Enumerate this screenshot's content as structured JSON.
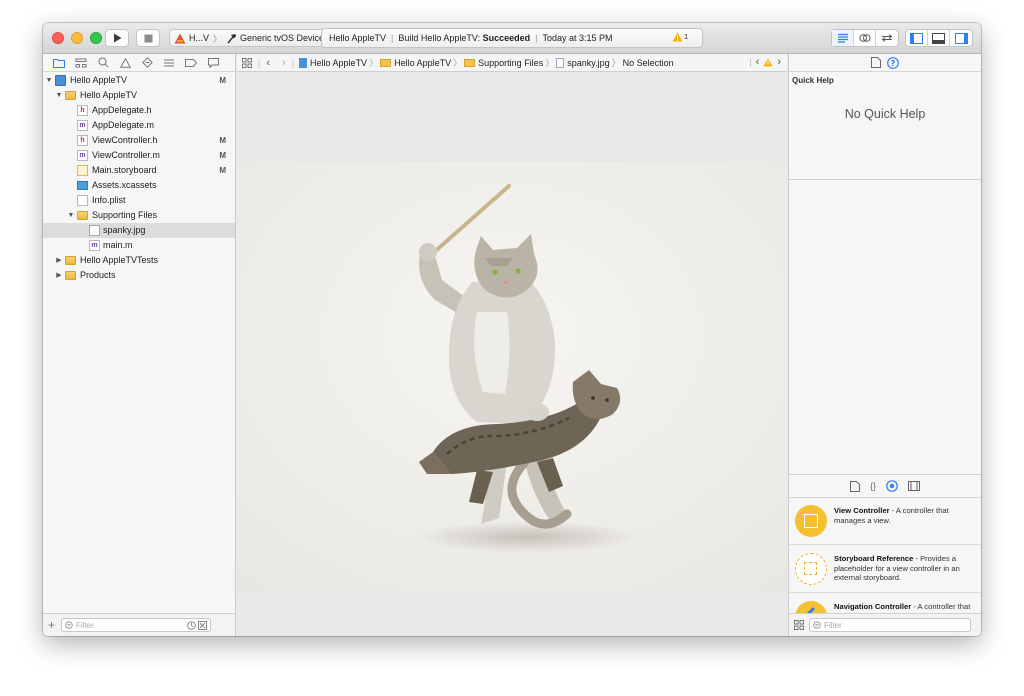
{
  "toolbar": {
    "scheme_short": "H...V",
    "destination": "Generic tvOS Device",
    "activity_project": "Hello AppleTV",
    "activity_status_prefix": "Build Hello AppleTV:",
    "activity_status_result": "Succeeded",
    "activity_time": "Today at 3:15 PM",
    "warning_count": "1"
  },
  "navigator": {
    "items": [
      {
        "label": "Hello AppleTV",
        "badge": "M"
      },
      {
        "label": "Hello AppleTV",
        "badge": ""
      },
      {
        "label": "AppDelegate.h",
        "badge": ""
      },
      {
        "label": "AppDelegate.m",
        "badge": ""
      },
      {
        "label": "ViewController.h",
        "badge": "M"
      },
      {
        "label": "ViewController.m",
        "badge": "M"
      },
      {
        "label": "Main.storyboard",
        "badge": "M"
      },
      {
        "label": "Assets.xcassets",
        "badge": ""
      },
      {
        "label": "Info.plist",
        "badge": ""
      },
      {
        "label": "Supporting Files",
        "badge": ""
      },
      {
        "label": "spanky.jpg",
        "badge": ""
      },
      {
        "label": "main.m",
        "badge": ""
      },
      {
        "label": "Hello AppleTVTests",
        "badge": ""
      },
      {
        "label": "Products",
        "badge": ""
      }
    ],
    "filter_placeholder": "Filter"
  },
  "jumpbar": {
    "crumbs": [
      "Hello AppleTV",
      "Hello AppleTV",
      "Supporting Files",
      "spanky.jpg",
      "No Selection"
    ]
  },
  "inspector": {
    "quick_help_title": "Quick Help",
    "no_help_text": "No Quick Help",
    "library": [
      {
        "title": "View Controller",
        "desc": " - A controller that manages a view."
      },
      {
        "title": "Storyboard Reference",
        "desc": " - Provides a placeholder for a view controller in an external storyboard."
      },
      {
        "title": "Navigation Controller",
        "desc": " - A controller that manages navigation through a hierarchy of views."
      }
    ],
    "filter_placeholder": "Filter"
  },
  "colors": {
    "accent": "#2f7cf6",
    "library_icon": "#f5c030",
    "warning": "#f5b400",
    "folder": "#f0c453"
  }
}
